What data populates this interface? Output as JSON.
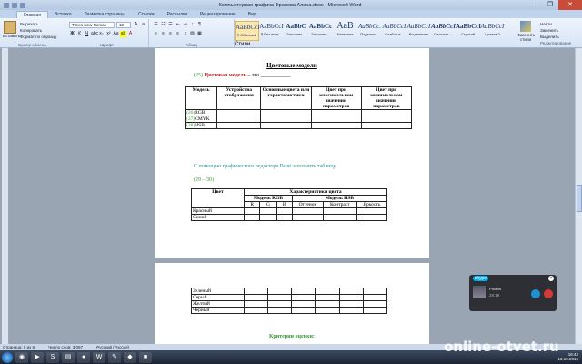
{
  "window": {
    "title": "Компьютерная графика Фролова Алина.docx - Microsoft Word",
    "min": "–",
    "max": "❐",
    "close": "✕"
  },
  "tabs": [
    "Главная",
    "Вставка",
    "Разметка страницы",
    "Ссылки",
    "Рассылки",
    "Рецензирование",
    "Вид"
  ],
  "ribbon": {
    "paste": "Вставить",
    "clip_items": [
      "Вырезать",
      "Копировать",
      "Формат по образцу"
    ],
    "clip_group": "Буфер обмена",
    "font_name": "Times New Roman",
    "font_size": "10",
    "font_group": "Шрифт",
    "para_group": "Абзац",
    "styles_group": "Стили",
    "styles": [
      {
        "sample": "AaBbCcI",
        "name": "¶ Обычный"
      },
      {
        "sample": "AaBbCcI",
        "name": "¶ Без инте..."
      },
      {
        "sample": "AaBbC",
        "name": "Заголово..."
      },
      {
        "sample": "AaBbCc",
        "name": "Заголово..."
      },
      {
        "sample": "AaB",
        "name": "Название"
      },
      {
        "sample": "AaBbCc.",
        "name": "Подзагол..."
      },
      {
        "sample": "AaBbCcI",
        "name": "Слабое в..."
      },
      {
        "sample": "AaBbCcI",
        "name": "Выделение"
      },
      {
        "sample": "AaBbCcI",
        "name": "Сильное ..."
      },
      {
        "sample": "AaBbCcI",
        "name": "Строгий"
      },
      {
        "sample": "AaBbCcI",
        "name": "Цитата 2"
      }
    ],
    "change_styles": "Изменить стили",
    "edit_items": [
      "Найти",
      "Заменить",
      "Выделить"
    ],
    "edit_group": "Редактирование"
  },
  "doc": {
    "title": "Цветовые модели",
    "q25_num": "(25)",
    "q25_term": "Цветовая модель",
    "q25_rest": "– это ___________",
    "table1": {
      "headers": [
        "Модель",
        "Устройства отображения",
        "Основные цвета или характеристики",
        "Цвет при максимальном значении параметров",
        "Цвет при минимальном значении параметров"
      ],
      "rows": [
        {
          "num": "(26)",
          "label": "RGB"
        },
        {
          "num": "(27)",
          "label": "CMYK"
        },
        {
          "num": "(28)",
          "label": "HSB"
        }
      ]
    },
    "paint_task": "С помощью графического редактора Paint заполнить таблицу",
    "range": "(29 – 30)",
    "table2": {
      "h_color": "Цвет",
      "h_char": "Характеристики цвета",
      "h_rgb": "Модель RGB",
      "h_hsb": "Модель HSB",
      "sub": [
        "R",
        "G",
        "B",
        "Оттенок",
        "Контраст",
        "Яркость"
      ],
      "rows_p1": [
        "Красный",
        "Синий"
      ],
      "rows_p2": [
        "Зеленый",
        "Серый",
        "Желтый",
        "Чёрный"
      ]
    },
    "criteria": "Критерии оценки:"
  },
  "skype": {
    "logo": "skype",
    "name": "Роман",
    "time": "28:19"
  },
  "status": {
    "page": "Страница: 8 из 8",
    "words": "Число слов: 3 097",
    "lang": "Русский (Россия)"
  },
  "taskbar": {
    "time": "16:42",
    "date": "13.10.2016"
  },
  "watermark": "online-otvet.ru"
}
